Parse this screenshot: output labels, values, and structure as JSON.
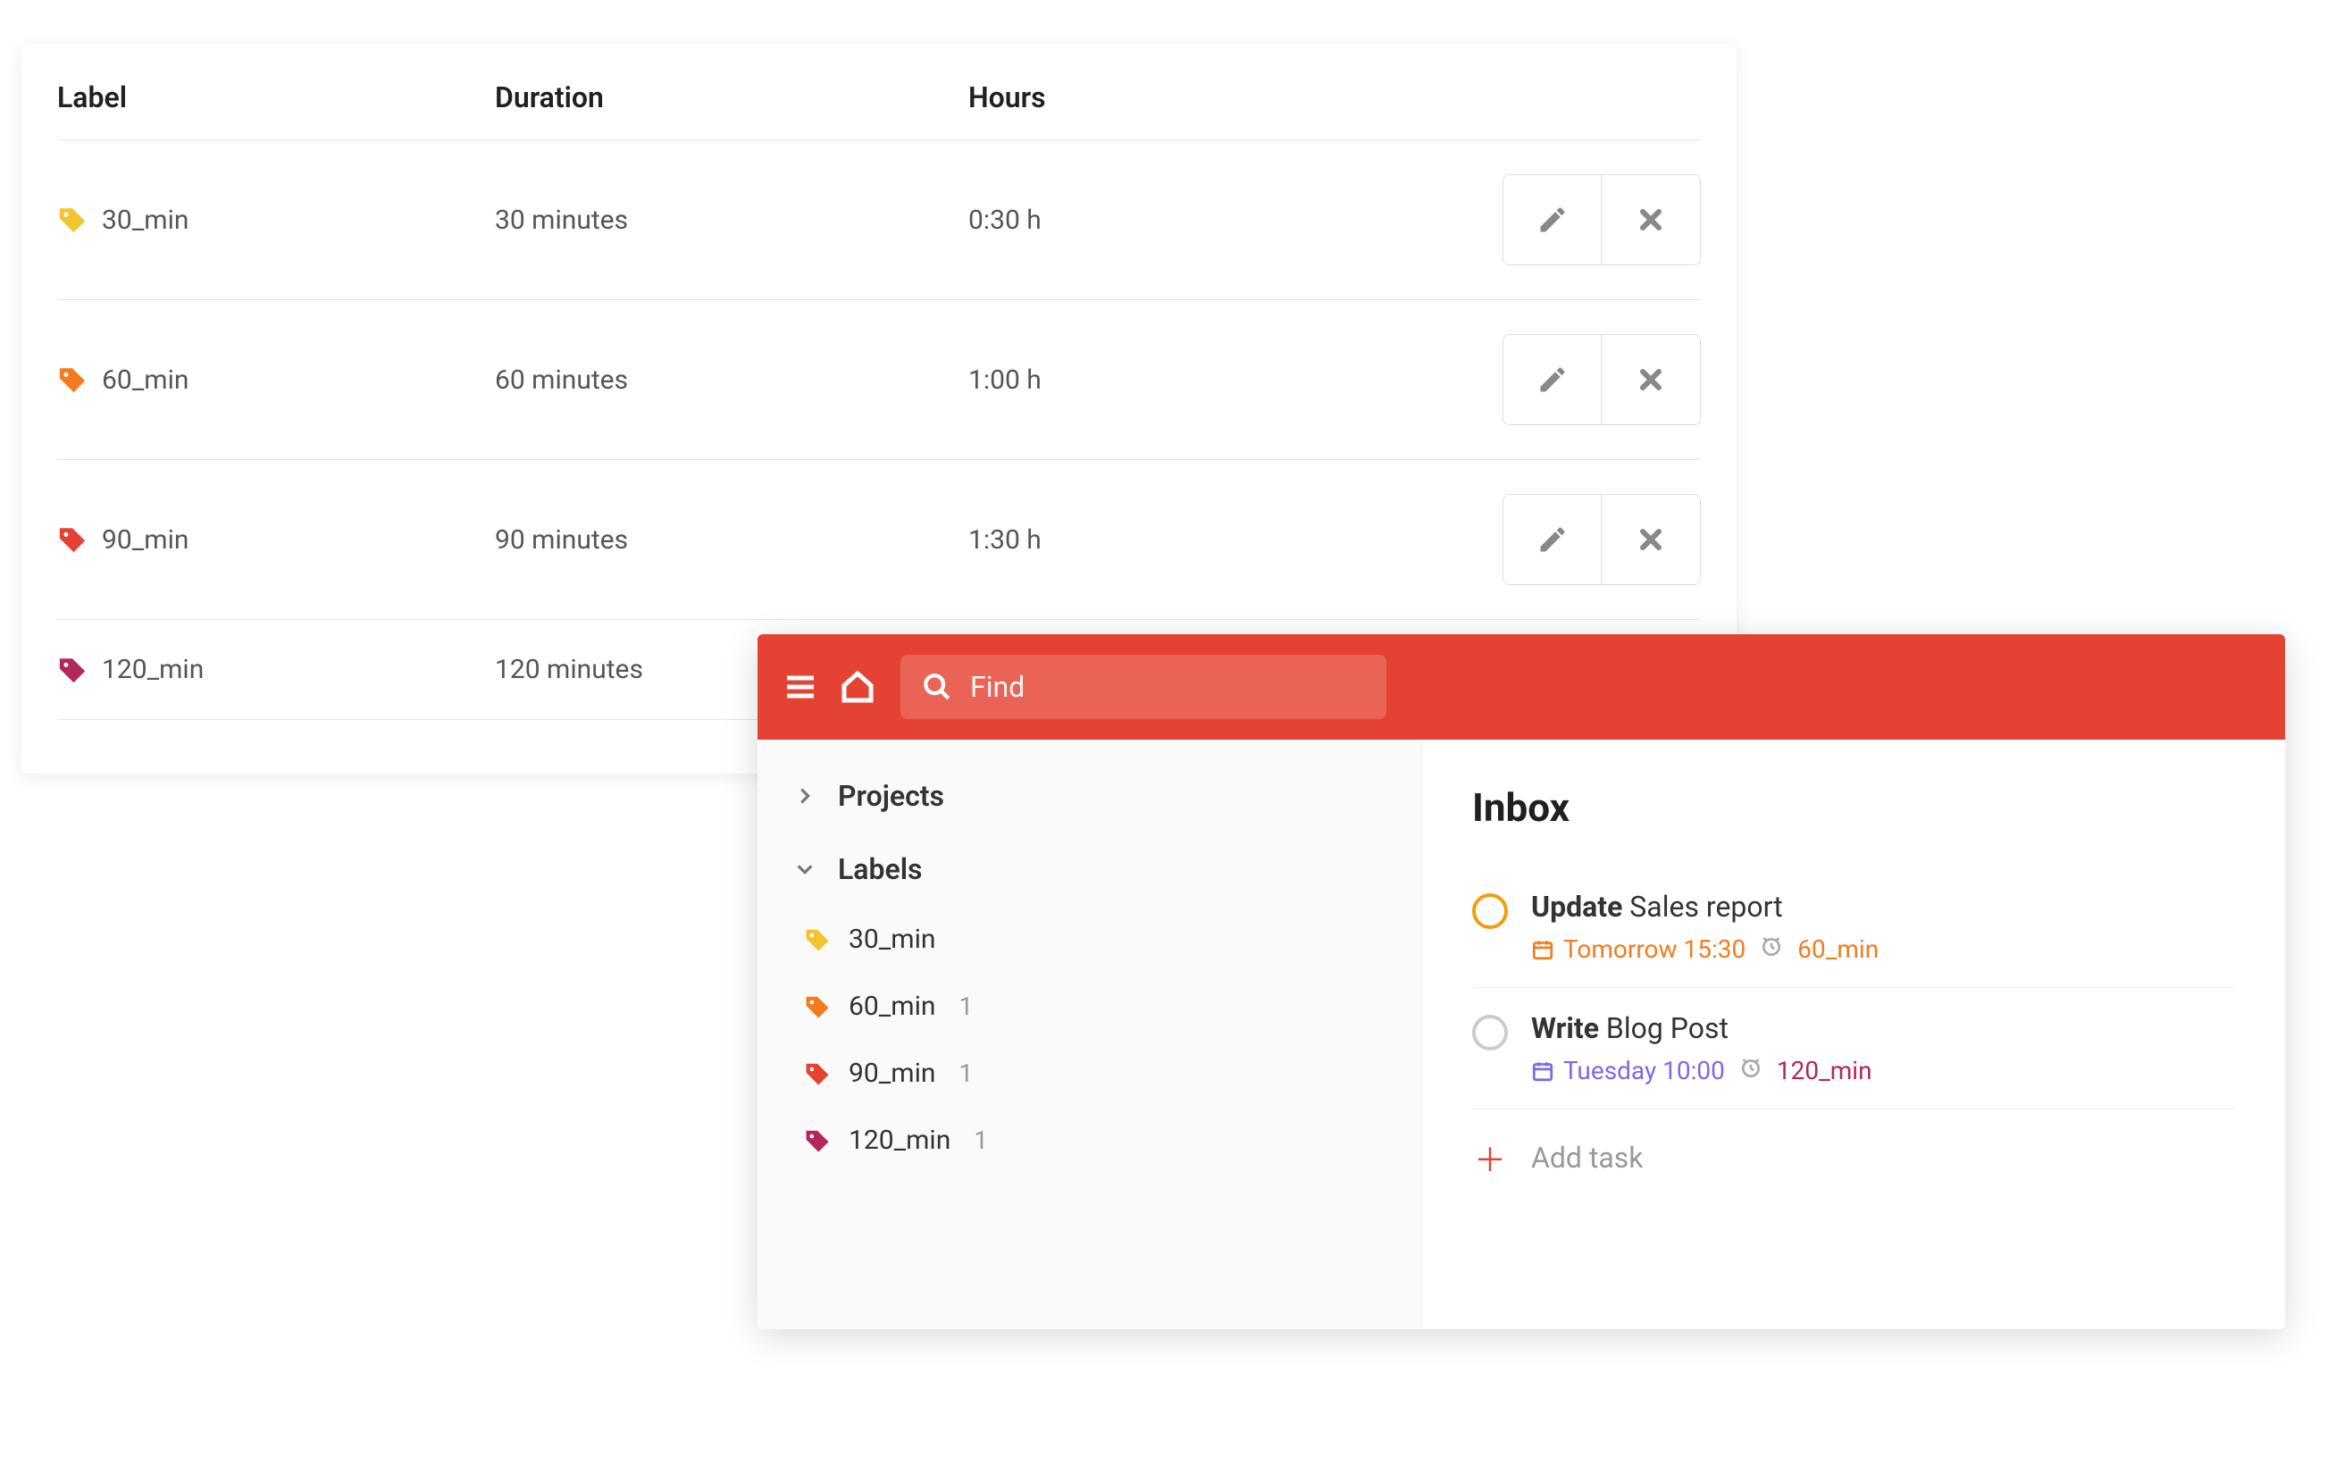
{
  "colors": {
    "yellow": "#f4c430",
    "orange": "#f47b1f",
    "red": "#e44232",
    "magenta": "#b3265e",
    "purple": "#7b68ee"
  },
  "table": {
    "headers": {
      "label": "Label",
      "duration": "Duration",
      "hours": "Hours"
    },
    "rows": [
      {
        "name": "30_min",
        "duration": "30 minutes",
        "hours": "0:30 h",
        "colorKey": "yellow",
        "actions": true
      },
      {
        "name": "60_min",
        "duration": "60 minutes",
        "hours": "1:00 h",
        "colorKey": "orange",
        "actions": true
      },
      {
        "name": "90_min",
        "duration": "90 minutes",
        "hours": "1:30 h",
        "colorKey": "red",
        "actions": true
      },
      {
        "name": "120_min",
        "duration": "120 minutes",
        "hours": "",
        "colorKey": "magenta",
        "actions": false
      }
    ]
  },
  "app": {
    "search_placeholder": "Find",
    "sidebar": {
      "projects": "Projects",
      "labels_header": "Labels",
      "labels": [
        {
          "name": "30_min",
          "count": "",
          "colorKey": "yellow"
        },
        {
          "name": "60_min",
          "count": "1",
          "colorKey": "orange"
        },
        {
          "name": "90_min",
          "count": "1",
          "colorKey": "red"
        },
        {
          "name": "120_min",
          "count": "1",
          "colorKey": "magenta"
        }
      ]
    },
    "main": {
      "title": "Inbox",
      "add_task": "Add task",
      "tasks": [
        {
          "bold": "Update",
          "rest": "Sales report",
          "date": "Tomorrow 15:30",
          "dateColor": "orange",
          "label": "60_min",
          "labelColor": "orange",
          "priority": true
        },
        {
          "bold": "Write",
          "rest": "Blog Post",
          "date": "Tuesday 10:00",
          "dateColor": "purple",
          "label": "120_min",
          "labelColor": "magenta",
          "priority": false
        }
      ]
    }
  }
}
